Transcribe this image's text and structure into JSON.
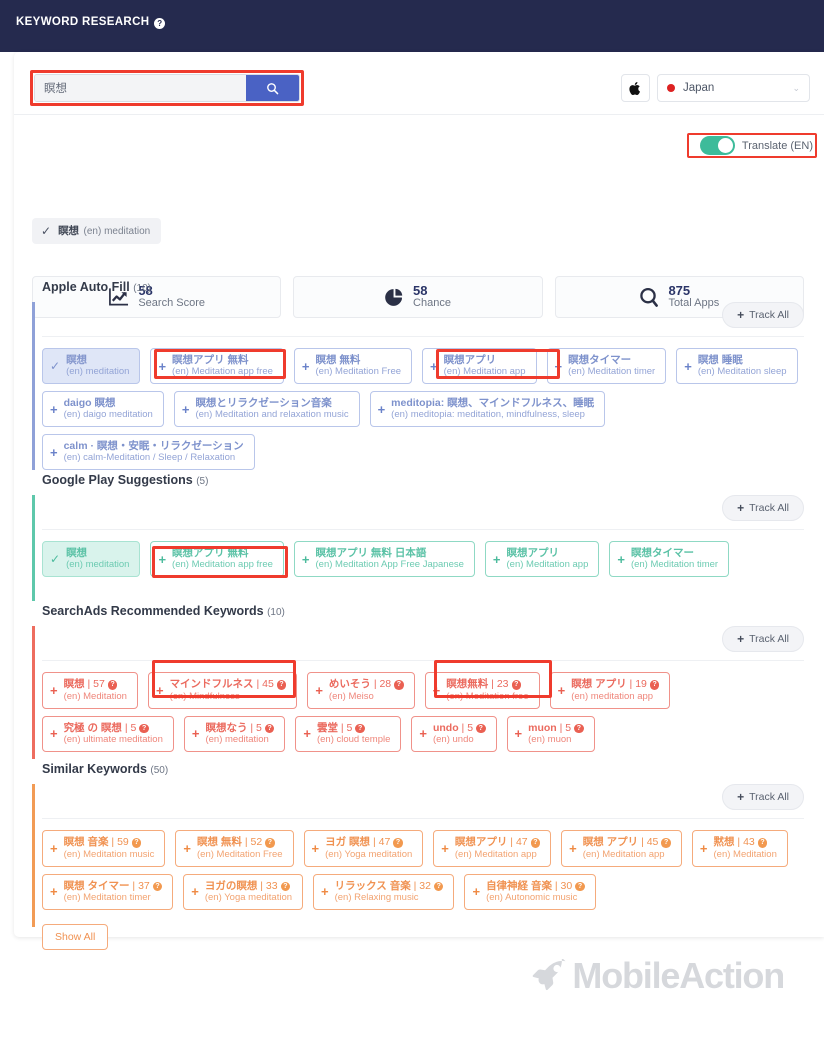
{
  "header": {
    "title": "KEYWORD RESEARCH",
    "help_icon": "?"
  },
  "search": {
    "value": "瞑想",
    "placeholder": "瞑想",
    "search_icon": "search-icon",
    "store_icon": "apple-icon",
    "country": "Japan",
    "country_chevron": "⌄"
  },
  "translate": {
    "label": "Translate (EN)",
    "enabled": true
  },
  "main_keyword": {
    "jp": "瞑想",
    "en": "(en) meditation",
    "check": "✓"
  },
  "stats": [
    {
      "value": "58",
      "label": "Search Score",
      "icon": "line-chart-icon"
    },
    {
      "value": "58",
      "label": "Chance",
      "icon": "pie-chart-icon"
    },
    {
      "value": "875",
      "label": "Total Apps",
      "icon": "magnifier-icon"
    }
  ],
  "sections": [
    {
      "id": "apple-auto-fill",
      "title": "Apple Auto Fill",
      "count": "(10)",
      "track_all": "Track All",
      "accent": "#8fa1d8",
      "chips": [
        {
          "jp": "瞑想",
          "en": "(en) meditation",
          "selected": true,
          "highlighted": false
        },
        {
          "jp": "瞑想アプリ 無料",
          "en": "(en) Meditation app free",
          "selected": false,
          "highlighted": true
        },
        {
          "jp": "瞑想 無料",
          "en": "(en) Meditation Free",
          "selected": false,
          "highlighted": false
        },
        {
          "jp": "瞑想アプリ",
          "en": "(en) Meditation app",
          "selected": false,
          "highlighted": true
        },
        {
          "jp": "瞑想タイマー",
          "en": "(en) Meditation timer",
          "selected": false,
          "highlighted": false
        },
        {
          "jp": "瞑想 睡眠",
          "en": "(en) Meditation sleep",
          "selected": false,
          "highlighted": false
        },
        {
          "jp": "daigo 瞑想",
          "en": "(en) daigo meditation",
          "selected": false,
          "highlighted": false
        },
        {
          "jp": "瞑想とリラクゼーション音楽",
          "en": "(en) Meditation and relaxation music",
          "selected": false,
          "highlighted": false
        },
        {
          "jp": "meditopia: 瞑想、マインドフルネス、睡眠",
          "en": "(en) meditopia: meditation, mindfulness, sleep",
          "selected": false,
          "highlighted": false
        },
        {
          "jp": "calm · 瞑想・安眠・リラクゼーション",
          "en": "(en) calm-Meditation / Sleep / Relaxation",
          "selected": false,
          "highlighted": false
        }
      ]
    },
    {
      "id": "google-play-suggestions",
      "title": "Google Play Suggestions",
      "count": "(5)",
      "track_all": "Track All",
      "accent": "#5ec8ab",
      "chips": [
        {
          "jp": "瞑想",
          "en": "(en) meditation",
          "selected": true,
          "highlighted": false
        },
        {
          "jp": "瞑想アプリ 無料",
          "en": "(en) Meditation app free",
          "selected": false,
          "highlighted": true
        },
        {
          "jp": "瞑想アプリ 無料 日本語",
          "en": "(en) Meditation App Free Japanese",
          "selected": false,
          "highlighted": false
        },
        {
          "jp": "瞑想アプリ",
          "en": "(en) Meditation app",
          "selected": false,
          "highlighted": false
        },
        {
          "jp": "瞑想タイマー",
          "en": "(en) Meditation timer",
          "selected": false,
          "highlighted": false
        }
      ]
    },
    {
      "id": "searchads-recommended-keywords",
      "title": "SearchAds Recommended Keywords",
      "count": "(10)",
      "track_all": "Track All",
      "accent": "#ee6d5f",
      "chips": [
        {
          "jp": "瞑想",
          "score": "57",
          "en": "(en) Meditation",
          "highlighted": false
        },
        {
          "jp": "マインドフルネス",
          "score": "45",
          "en": "(en) Mindfulness",
          "highlighted": true
        },
        {
          "jp": "めいそう",
          "score": "28",
          "en": "(en) Meiso",
          "highlighted": false
        },
        {
          "jp": "瞑想無料",
          "score": "23",
          "en": "(en) Meditation free",
          "highlighted": true
        },
        {
          "jp": "瞑想 アプリ",
          "score": "19",
          "en": "(en) meditation app",
          "highlighted": false
        },
        {
          "jp": "究極 の 瞑想",
          "score": "5",
          "en": "(en) ultimate meditation",
          "highlighted": false
        },
        {
          "jp": "瞑想なう",
          "score": "5",
          "en": "(en) meditation",
          "highlighted": false
        },
        {
          "jp": "雲堂",
          "score": "5",
          "en": "(en) cloud temple",
          "highlighted": false
        },
        {
          "jp": "undo",
          "score": "5",
          "en": "(en) undo",
          "highlighted": false
        },
        {
          "jp": "muon",
          "score": "5",
          "en": "(en) muon",
          "highlighted": false
        }
      ]
    },
    {
      "id": "similar-keywords",
      "title": "Similar Keywords",
      "count": "(50)",
      "track_all": "Track All",
      "accent": "#f29b55",
      "show_all": "Show All",
      "chips": [
        {
          "jp": "瞑想 音楽",
          "score": "59",
          "en": "(en) Meditation music",
          "highlighted": false
        },
        {
          "jp": "瞑想 無料",
          "score": "52",
          "en": "(en) Meditation Free",
          "highlighted": false
        },
        {
          "jp": "ヨガ 瞑想",
          "score": "47",
          "en": "(en) Yoga meditation",
          "highlighted": false
        },
        {
          "jp": "瞑想アプリ",
          "score": "47",
          "en": "(en) Meditation app",
          "highlighted": false
        },
        {
          "jp": "瞑想 アプリ",
          "score": "45",
          "en": "(en) Meditation app",
          "highlighted": false
        },
        {
          "jp": "黙想",
          "score": "43",
          "en": "(en) Meditation",
          "highlighted": false
        },
        {
          "jp": "瞑想 タイマー",
          "score": "37",
          "en": "(en) Meditation timer",
          "highlighted": false
        },
        {
          "jp": "ヨガの瞑想",
          "score": "33",
          "en": "(en) Yoga meditation",
          "highlighted": false
        },
        {
          "jp": "リラックス 音楽",
          "score": "32",
          "en": "(en) Relaxing music",
          "highlighted": false
        },
        {
          "jp": "自律神経 音楽",
          "score": "30",
          "en": "(en) Autonomic music",
          "highlighted": false
        }
      ]
    }
  ],
  "footer": {
    "brand": "MobileAction",
    "logo_icon": "rocket-icon"
  },
  "colors": {
    "header_bg": "#252a4e",
    "highlight": "#ef3b2d",
    "apple": "#8fa1d8",
    "google": "#5ec8ab",
    "searchads": "#ee6d5f",
    "similar": "#f29b55",
    "toggle_on": "#3dbb9a",
    "search_button": "#4a62c4"
  }
}
